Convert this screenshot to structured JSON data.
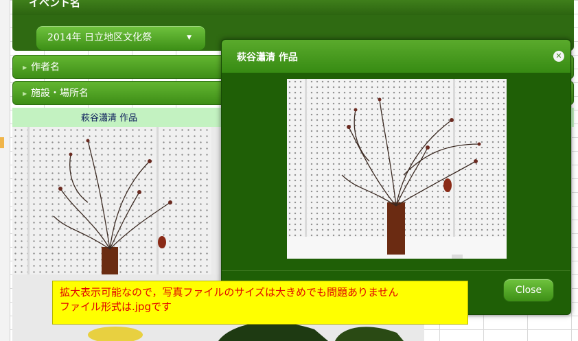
{
  "header": {
    "title": "イベント名"
  },
  "filter": {
    "event_select_value": "2014年 日立地区文化祭"
  },
  "accordion": {
    "items": [
      {
        "label": "作者名"
      },
      {
        "label": "施設・場所名"
      }
    ]
  },
  "gallery": {
    "caption": "萩谷瀟清 作品"
  },
  "modal": {
    "title": "萩谷瀟清 作品",
    "close_button": "Close"
  },
  "note": {
    "lines": [
      "拡大表示可能なので，写真ファイルのサイズは大きめでも問題ありません",
      "ファイル形式は.jpgです"
    ]
  },
  "colors": {
    "header_green": "#2f6a12",
    "button_green": "#4fa321",
    "caption_bg": "#c3f2c1",
    "note_bg": "#ffff00",
    "note_text": "#e10000"
  },
  "icons": [
    "chevron-down-icon",
    "chevron-right-icon",
    "close-circle-icon"
  ]
}
